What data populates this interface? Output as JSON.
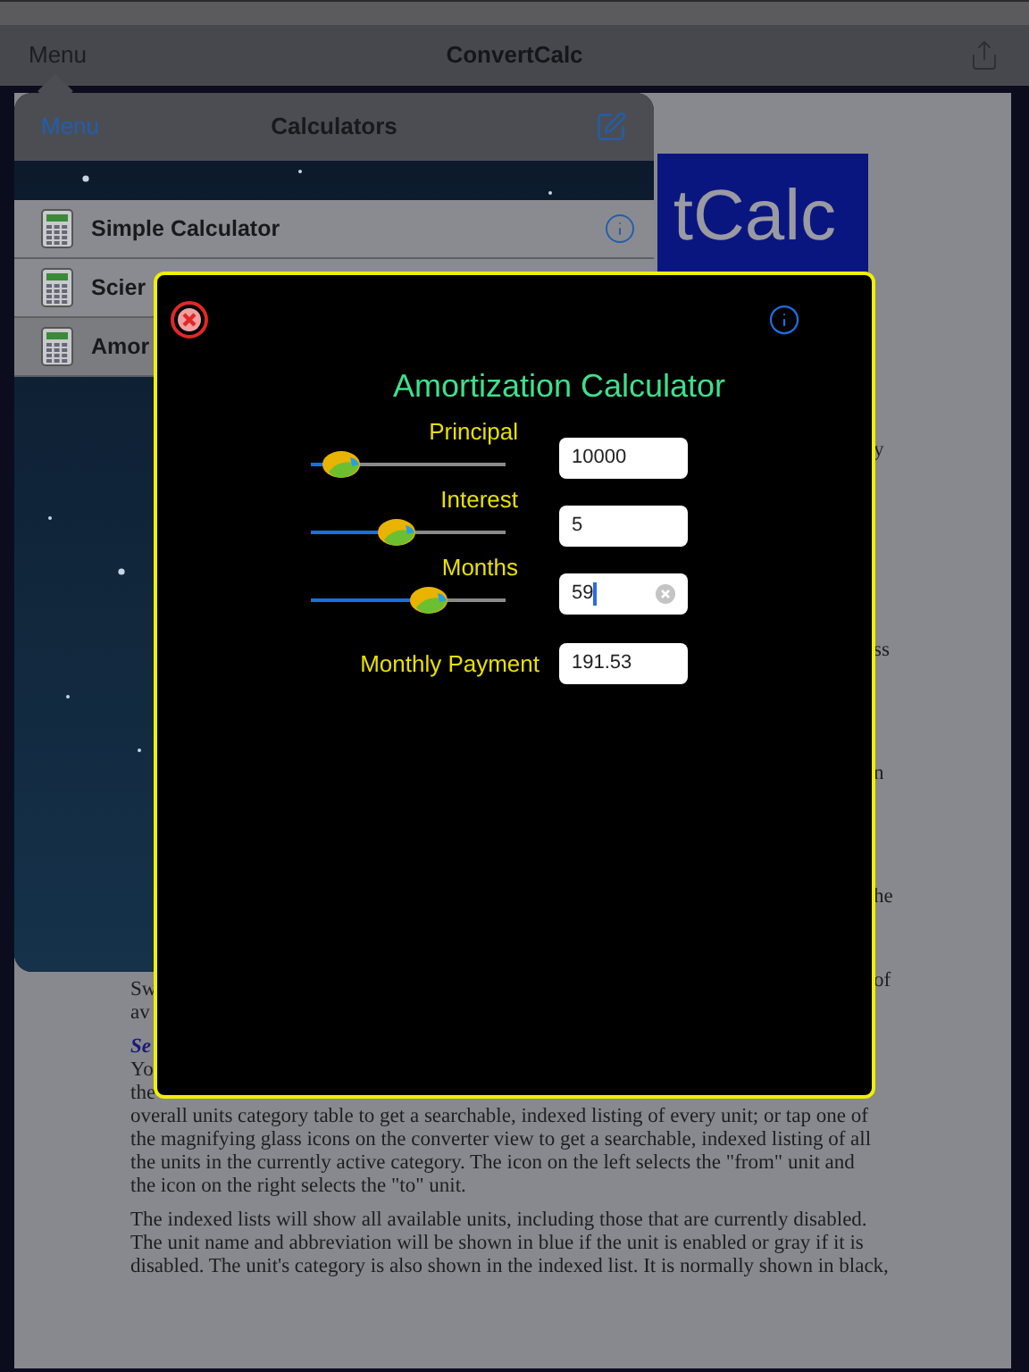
{
  "nav_bar": {
    "menu": "Menu",
    "title": "ConvertCalc"
  },
  "document": {
    "banner": "tCalc",
    "heading": "Se",
    "paragraphs": [
      [
        "Sw",
        "av"
      ],
      [
        "Yo",
        "the",
        "overall units category table to get a searchable, indexed listing of every unit; or tap one of",
        "the magnifying glass icons on the converter view to get a searchable, indexed listing of all",
        "the units in the currently active category. The icon on the left selects the \"from\" unit and",
        "the icon on the right selects the \"to\" unit."
      ],
      [
        "The indexed lists will show all available units, including those that are currently disabled.",
        "The unit name and abbreviation will be shown in blue if the unit is enabled or gray if it is",
        "disabled. The unit's category is also shown in the indexed list. It is normally shown in black,"
      ]
    ],
    "edge_fragments": [
      "y",
      "ss",
      "n",
      "he",
      "of"
    ]
  },
  "menu_popover": {
    "back": "Menu",
    "title": "Calculators",
    "items": [
      {
        "label": "Simple Calculator",
        "selected": false,
        "info": true
      },
      {
        "label": "Scier",
        "selected": false
      },
      {
        "label": "Amor",
        "selected": true
      }
    ]
  },
  "calculator": {
    "title": "Amortization Calculator",
    "inputs": [
      {
        "label": "Principal",
        "level": 0.15,
        "value": "10000",
        "focused": false
      },
      {
        "label": "Interest",
        "level": 0.43,
        "value": "5",
        "focused": false
      },
      {
        "label": "Months",
        "level": 0.6,
        "value": "59",
        "focused": true
      }
    ],
    "result": {
      "label": "Monthly Payment",
      "value": "191.53"
    }
  }
}
